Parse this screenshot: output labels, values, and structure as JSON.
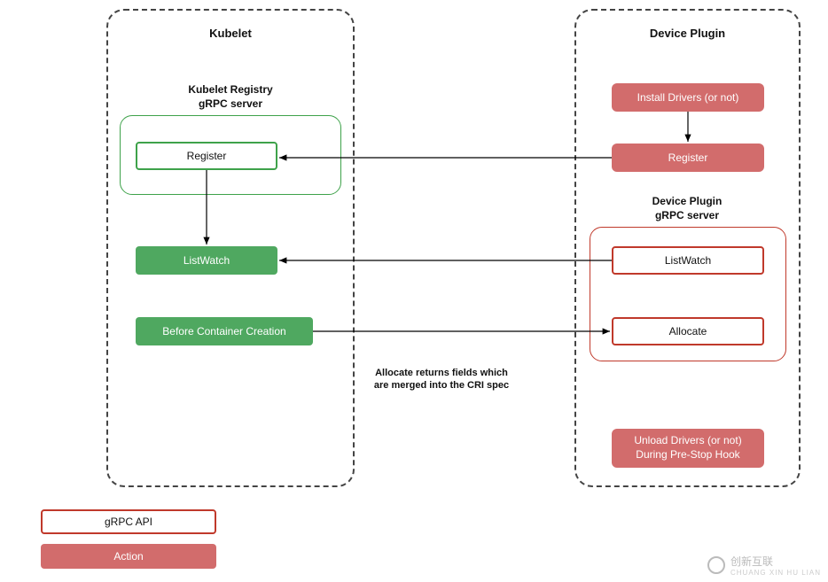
{
  "kubelet": {
    "title": "Kubelet",
    "registry_title": "Kubelet Registry\ngRPC server",
    "register": "Register",
    "listwatch": "ListWatch",
    "before_container": "Before Container Creation"
  },
  "device_plugin": {
    "title": "Device Plugin",
    "install_drivers": "Install Drivers (or not)",
    "register": "Register",
    "server_title": "Device Plugin\ngRPC server",
    "listwatch": "ListWatch",
    "allocate": "Allocate",
    "unload_drivers": "Unload Drivers (or not)\nDuring Pre-Stop Hook"
  },
  "annotation": {
    "allocate_note": "Allocate returns fields which\nare merged into the CRI spec"
  },
  "legend": {
    "api": "gRPC API",
    "action": "Action"
  },
  "watermark": {
    "brand": "创新互联",
    "sub": "CHUANG XIN HU LIAN"
  },
  "chart_data": {
    "type": "diagram",
    "nodes": [
      {
        "id": "kubelet",
        "label": "Kubelet",
        "type": "container"
      },
      {
        "id": "kubelet_registry",
        "label": "Kubelet Registry gRPC server",
        "type": "grpc_server",
        "parent": "kubelet"
      },
      {
        "id": "k_register",
        "label": "Register",
        "type": "grpc_api",
        "parent": "kubelet_registry"
      },
      {
        "id": "k_listwatch",
        "label": "ListWatch",
        "type": "action",
        "parent": "kubelet"
      },
      {
        "id": "k_before_cc",
        "label": "Before Container Creation",
        "type": "action",
        "parent": "kubelet"
      },
      {
        "id": "device_plugin",
        "label": "Device Plugin",
        "type": "container"
      },
      {
        "id": "dp_install",
        "label": "Install Drivers (or not)",
        "type": "action",
        "parent": "device_plugin"
      },
      {
        "id": "dp_register",
        "label": "Register",
        "type": "action",
        "parent": "device_plugin"
      },
      {
        "id": "dp_server",
        "label": "Device Plugin gRPC server",
        "type": "grpc_server",
        "parent": "device_plugin"
      },
      {
        "id": "dp_listwatch",
        "label": "ListWatch",
        "type": "grpc_api",
        "parent": "dp_server"
      },
      {
        "id": "dp_allocate",
        "label": "Allocate",
        "type": "grpc_api",
        "parent": "dp_server"
      },
      {
        "id": "dp_unload",
        "label": "Unload Drivers (or not) During Pre-Stop Hook",
        "type": "action",
        "parent": "device_plugin"
      }
    ],
    "edges": [
      {
        "from": "dp_install",
        "to": "dp_register",
        "direction": "down"
      },
      {
        "from": "dp_register",
        "to": "k_register",
        "direction": "left"
      },
      {
        "from": "k_register",
        "to": "k_listwatch",
        "direction": "down"
      },
      {
        "from": "dp_listwatch",
        "to": "k_listwatch",
        "direction": "left"
      },
      {
        "from": "k_before_cc",
        "to": "dp_allocate",
        "direction": "right",
        "note": "Allocate returns fields which are merged into the CRI spec"
      }
    ],
    "legend": {
      "grpc_api": "gRPC API (outlined box)",
      "action": "Action (filled box)"
    }
  }
}
